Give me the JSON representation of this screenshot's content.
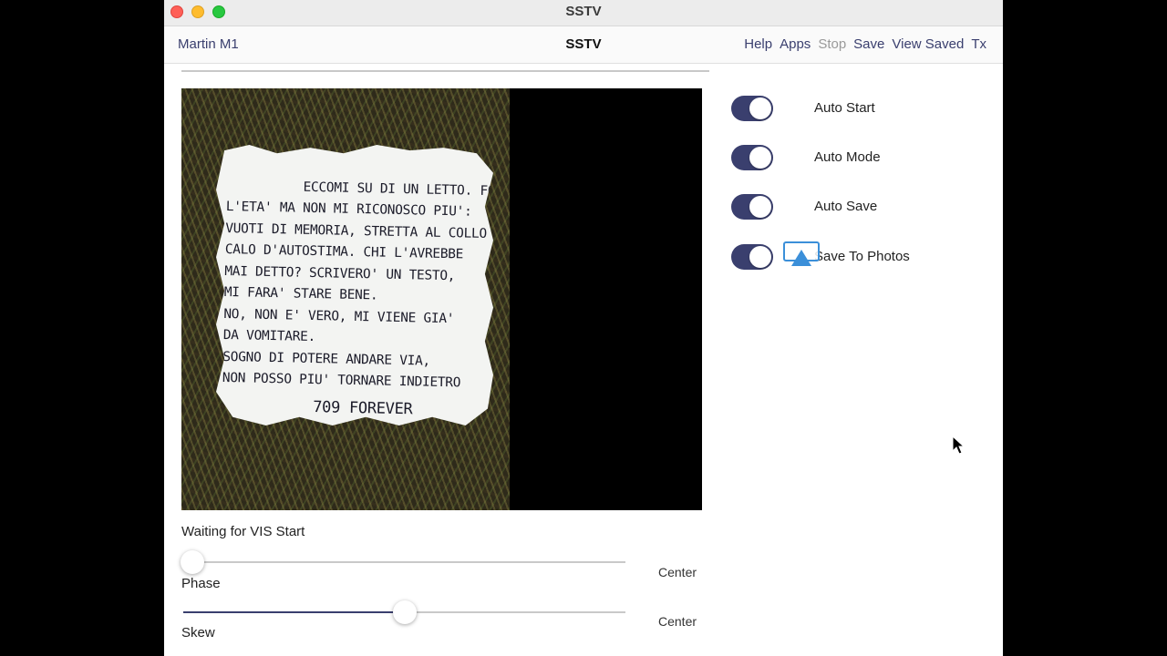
{
  "window": {
    "title": "SSTV"
  },
  "navbar": {
    "mode": "Martin M1",
    "title": "SSTV",
    "actions": [
      {
        "label": "Help",
        "enabled": true
      },
      {
        "label": "Apps",
        "enabled": true
      },
      {
        "label": "Stop",
        "enabled": false
      },
      {
        "label": "Save",
        "enabled": true
      },
      {
        "label": "View Saved",
        "enabled": true
      },
      {
        "label": "Tx",
        "enabled": true
      }
    ]
  },
  "receiver": {
    "progress_fraction": 0.0,
    "image_note_lines": [
      "ECCOMI SU DI UN LETTO. FORSE SARA'",
      "L'ETA' MA NON MI RICONOSCO PIU':",
      "VUOTI DI MEMORIA, STRETTA AL COLLO",
      "CALO D'AUTOSTIMA. CHI L'AVREBBE",
      "MAI DETTO? SCRIVERO' UN TESTO,",
      "MI FARA' STARE BENE.",
      "NO, NON E' VERO, MI VIENE GIA'",
      "DA VOMITARE.",
      "SOGNO DI POTERE ANDARE VIA,",
      "NON POSSO PIU' TORNARE INDIETRO"
    ],
    "image_note_signature": "709 FOREVER",
    "status": "Waiting for VIS Start"
  },
  "sliders": {
    "phase": {
      "label": "Phase",
      "value_fraction": 0.02,
      "button": "Center"
    },
    "skew": {
      "label": "Skew",
      "value_fraction": 0.5,
      "button": "Center"
    }
  },
  "toggles": [
    {
      "label": "Auto Start",
      "on": true
    },
    {
      "label": "Auto Mode",
      "on": true
    },
    {
      "label": "Auto Save",
      "on": true
    },
    {
      "label": "Save To Photos",
      "on": true
    }
  ],
  "colors": {
    "accent": "#3a3f6e",
    "airplay": "#3b8fd9"
  },
  "icons": {
    "overlay": "airplay-icon",
    "pointer": "mouse-cursor-icon"
  }
}
